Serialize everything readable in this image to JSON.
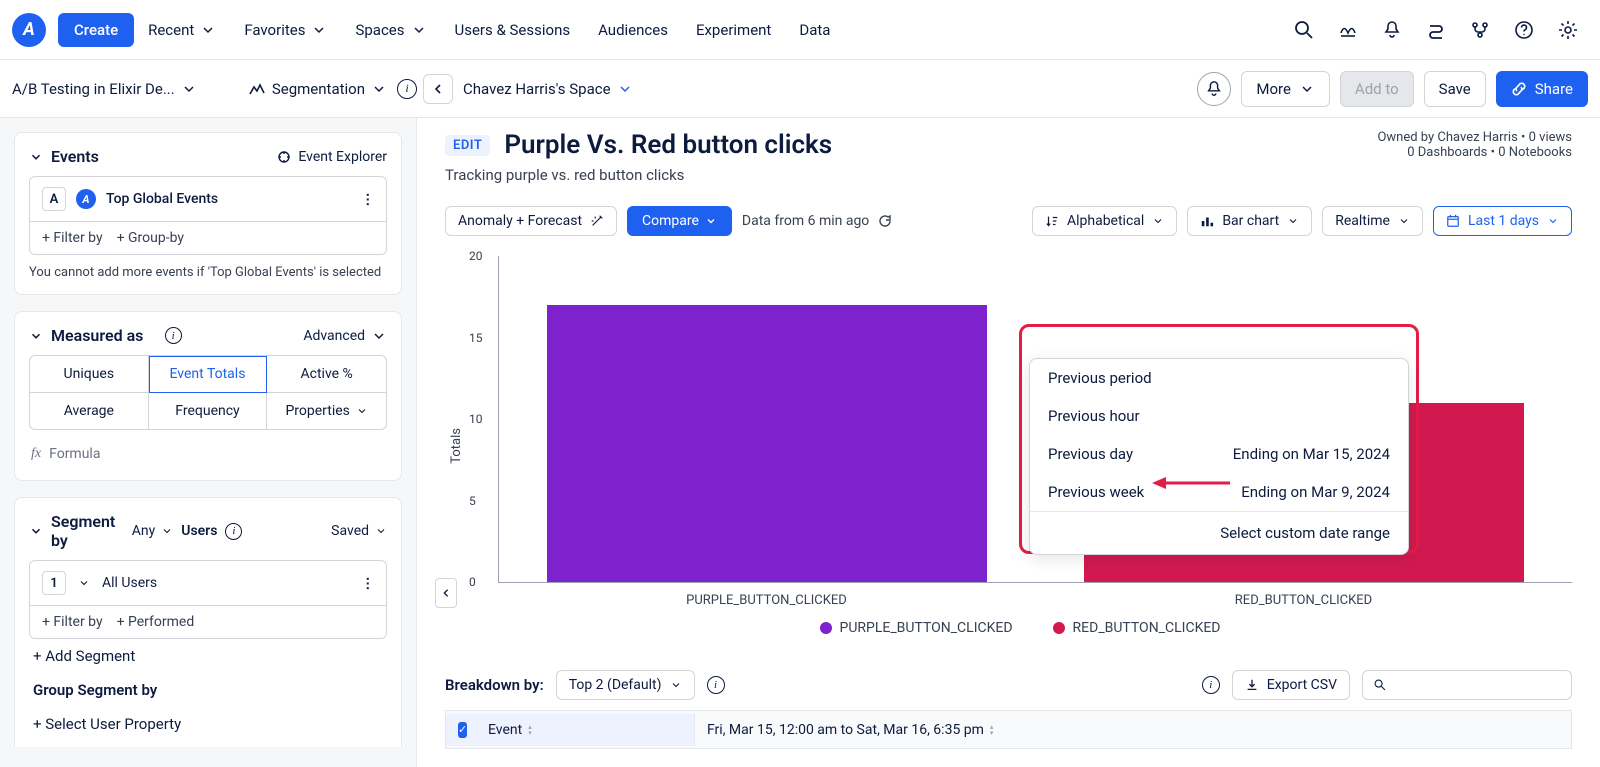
{
  "nav": {
    "create": "Create",
    "items": [
      "Recent",
      "Favorites",
      "Spaces",
      "Users & Sessions",
      "Audiences",
      "Experiment",
      "Data"
    ]
  },
  "secbar": {
    "project": "A/B Testing in Elixir De...",
    "chart_type": "Segmentation",
    "space": "Chavez Harris's Space",
    "more": "More",
    "add_to": "Add to",
    "save": "Save",
    "share": "Share"
  },
  "sidebar": {
    "events": {
      "title": "Events",
      "explorer": "Event Explorer",
      "letter": "A",
      "event_name": "Top Global Events",
      "filter_by": "+ Filter by",
      "group_by": "+ Group-by",
      "warn": "You cannot add more events if 'Top Global Events' is selected"
    },
    "measured": {
      "title": "Measured as",
      "advanced": "Advanced",
      "cells": [
        "Uniques",
        "Event Totals",
        "Active %",
        "Average",
        "Frequency",
        "Properties"
      ],
      "formula": "Formula"
    },
    "segment": {
      "title": "Segment by",
      "any": "Any",
      "users": "Users",
      "saved": "Saved",
      "num": "1",
      "name": "All Users",
      "filter_by": "+ Filter by",
      "performed": "+ Performed",
      "add": "+ Add Segment",
      "group": "Group Segment by",
      "user_prop": "+ Select User Property"
    }
  },
  "content": {
    "edit": "EDIT",
    "title": "Purple Vs. Red button clicks",
    "subtitle": "Tracking purple vs. red button clicks",
    "owner1": "Owned by Chavez Harris • 0 views",
    "owner2": "0 Dashboards • 0 Notebooks",
    "toolbar": {
      "anomaly": "Anomaly + Forecast",
      "compare": "Compare",
      "data_from": "Data from 6 min ago",
      "alpha": "Alphabetical",
      "bar": "Bar chart",
      "realtime": "Realtime",
      "range": "Last 1 days"
    },
    "compare_menu": {
      "rows": [
        {
          "label": "Previous period",
          "ending": ""
        },
        {
          "label": "Previous hour",
          "ending": ""
        },
        {
          "label": "Previous day",
          "ending": "Ending on Mar 15, 2024"
        },
        {
          "label": "Previous week",
          "ending": "Ending on Mar 9, 2024"
        }
      ],
      "custom": "Select custom date range"
    },
    "breakdown": {
      "label": "Breakdown by:",
      "top": "Top 2 (Default)",
      "export": "Export CSV",
      "event_col": "Event",
      "date_col": "Fri, Mar 15, 12:00 am to Sat, Mar 16, 6:35 pm"
    }
  },
  "chart_data": {
    "type": "bar",
    "ylabel": "Totals",
    "ylim": [
      0,
      20
    ],
    "yticks": [
      0,
      5,
      10,
      15,
      20
    ],
    "categories": [
      "PURPLE_BUTTON_CLICKED",
      "RED_BUTTON_CLICKED"
    ],
    "series": [
      {
        "name": "PURPLE_BUTTON_CLICKED",
        "color": "#7e22ce",
        "values": [
          17,
          null
        ]
      },
      {
        "name": "RED_BUTTON_CLICKED",
        "color": "#d11950",
        "values": [
          null,
          11
        ]
      }
    ],
    "bars": [
      {
        "category": "PURPLE_BUTTON_CLICKED",
        "value": 17,
        "color": "#7e22ce",
        "label": ""
      },
      {
        "category": "RED_BUTTON_CLICKED",
        "value": 11,
        "color": "#d11950",
        "label": "11"
      }
    ]
  }
}
